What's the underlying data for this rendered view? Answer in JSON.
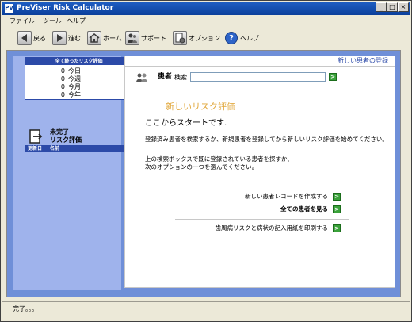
{
  "window": {
    "title": "PreViser Risk Calculator",
    "icon_text": "PV"
  },
  "menu": {
    "file": "ファイル",
    "tools": "ツール",
    "help": "ヘルプ"
  },
  "toolbar": {
    "back": "戻る",
    "forward": "進む",
    "home": "ホーム",
    "support": "サポート",
    "options": "オプション",
    "help": "ヘルプ"
  },
  "stats": {
    "header": "全て終ったリスク評価",
    "rows": [
      {
        "count": "0",
        "label": "今日"
      },
      {
        "count": "0",
        "label": "今週"
      },
      {
        "count": "0",
        "label": "今月"
      },
      {
        "count": "0",
        "label": "今年"
      }
    ]
  },
  "incomplete": {
    "label": "未完了\nリスク評価",
    "col_date": "更新日",
    "col_name": "名前"
  },
  "main": {
    "new_patient_link": "新しい患者の登録",
    "patient_label": "患者",
    "search_label": "検索",
    "search_value": "",
    "go_symbol": ">",
    "heading_new": "新しいリスク評価",
    "heading_start": "ここからスタートです.",
    "para1": "登録済み患者を検索するか、新規患者を登録してから新しいリスク評価を始めてください。",
    "para2_line1": "上の検索ボックスで既に登録されている患者を探すか、",
    "para2_line2": "次のオプションの一つを選んでください。",
    "opt_new_record": "新しい患者レコードを作成する",
    "opt_view_all": "全ての患者を見る",
    "opt_print": "歯周病リスクと病状の記入用紙を印刷する"
  },
  "status": {
    "text": "完了。。。"
  },
  "colors": {
    "title_blue": "#0b3f9b",
    "content_blue": "#6f8fd8",
    "panel_blue": "#9fb3ec",
    "header_blue": "#2c4aa8",
    "accent_orange": "#e1a73a",
    "go_green": "#3aa23a"
  },
  "icons": {
    "back": "arrow-left-icon",
    "forward": "arrow-right-icon",
    "home": "house-icon",
    "support": "people-icon",
    "options": "gear-icon",
    "help": "question-icon",
    "patients": "patients-icon",
    "incomplete": "document-arrow-icon"
  }
}
